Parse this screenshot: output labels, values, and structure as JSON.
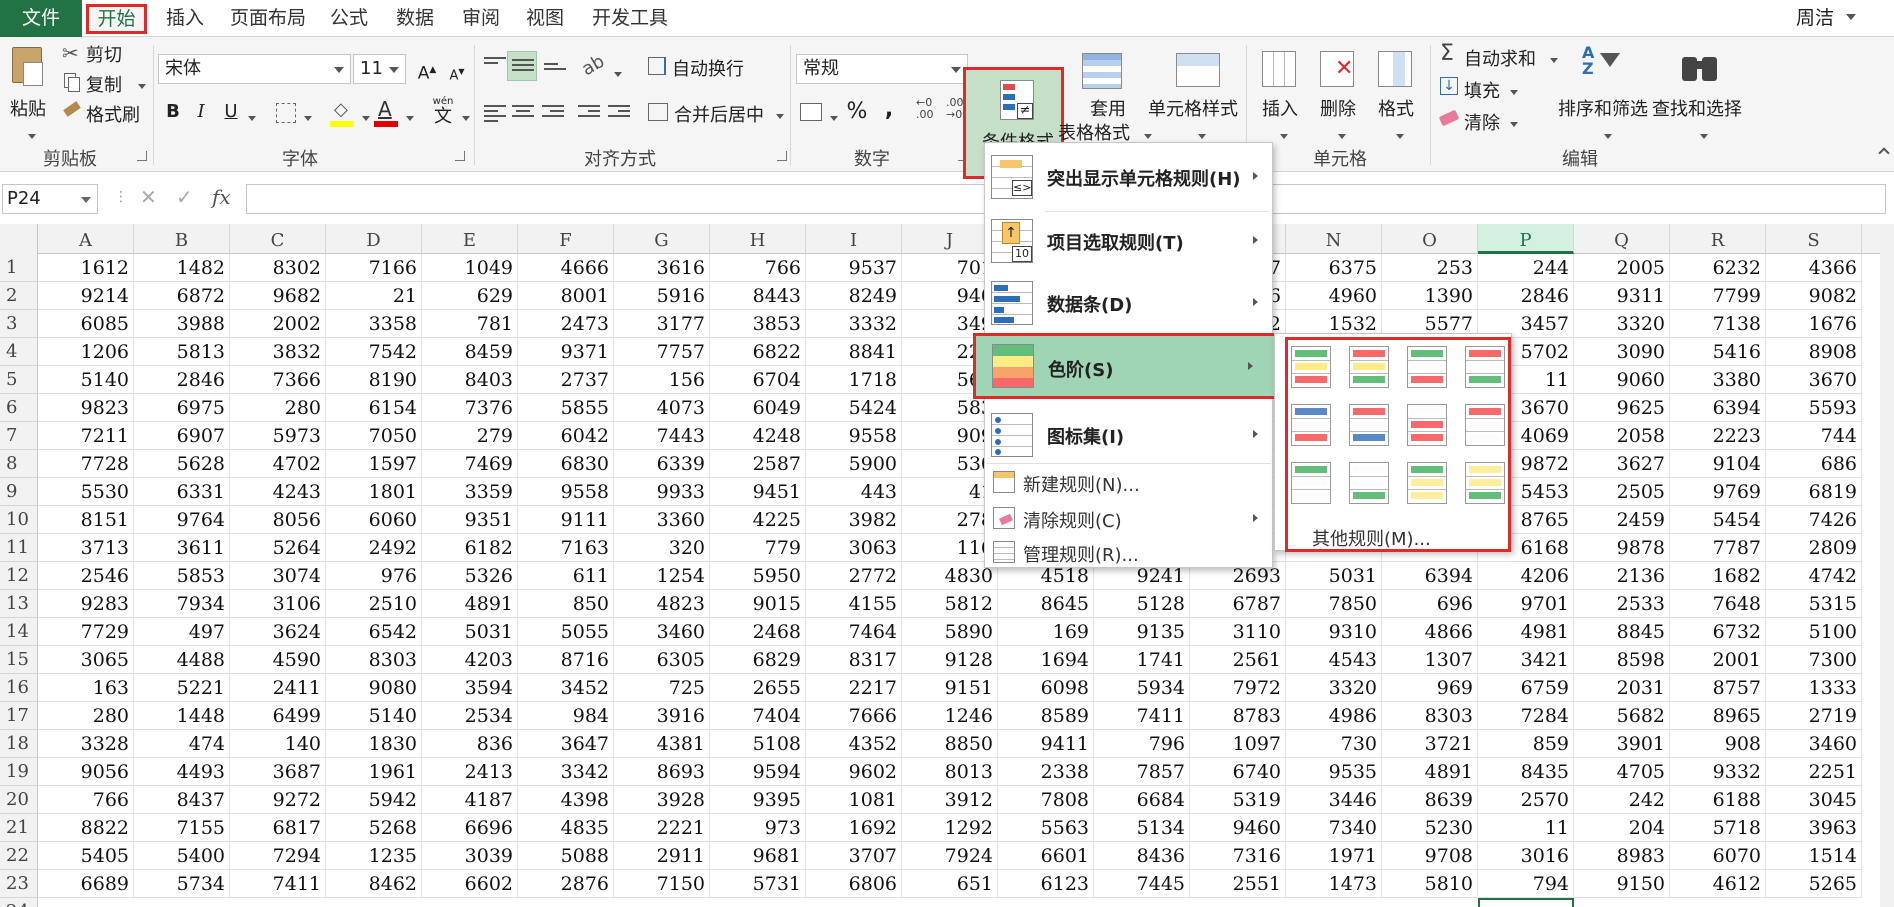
{
  "tabs": {
    "file": "文件",
    "home": "开始",
    "insert": "插入",
    "page_layout": "页面布局",
    "formulas": "公式",
    "data": "数据",
    "review": "审阅",
    "view": "视图",
    "developer": "开发工具",
    "user": "周洁"
  },
  "ribbon": {
    "clipboard": {
      "label": "剪贴板",
      "paste": "粘贴",
      "cut": "剪切",
      "copy": "复制",
      "format_painter": "格式刷"
    },
    "font": {
      "label": "字体",
      "font_name": "宋体",
      "font_size": "11",
      "bold": "B",
      "italic": "I",
      "underline": "U",
      "phonetic": "wén",
      "phonetic_char": "文"
    },
    "alignment": {
      "label": "对齐方式",
      "wrap": "自动换行",
      "merge": "合并后居中"
    },
    "number": {
      "label": "数字",
      "format": "常规",
      "percent": "%",
      "comma": ","
    },
    "styles": {
      "conditional": "条件格式",
      "table_line1": "套用",
      "table_line2": "表格格式",
      "cell_styles": "单元格样式"
    },
    "cells": {
      "label": "单元格",
      "insert": "插入",
      "delete": "删除",
      "format": "格式"
    },
    "editing": {
      "label": "编辑",
      "autosum": "自动求和",
      "fill": "填充",
      "clear": "清除",
      "sort": "排序和筛选",
      "find": "查找和选择"
    }
  },
  "formula_bar": {
    "name_box": "P24",
    "fx": "fx",
    "value": ""
  },
  "columns": [
    "A",
    "B",
    "C",
    "D",
    "E",
    "F",
    "G",
    "H",
    "I",
    "J",
    "K",
    "L",
    "M",
    "N",
    "O",
    "P",
    "Q",
    "R",
    "S"
  ],
  "selected_column": "P",
  "rows": [
    [
      "1612",
      "1482",
      "8302",
      "7166",
      "1049",
      "4666",
      "3616",
      "766",
      "9537",
      "701",
      "",
      "",
      "7",
      "6375",
      "253",
      "244",
      "2005",
      "6232",
      "4366"
    ],
    [
      "9214",
      "6872",
      "9682",
      "21",
      "629",
      "8001",
      "5916",
      "8443",
      "8249",
      "940",
      "",
      "",
      "6",
      "4960",
      "1390",
      "2846",
      "9311",
      "7799",
      "9082"
    ],
    [
      "6085",
      "3988",
      "2002",
      "3358",
      "781",
      "2473",
      "3177",
      "3853",
      "3332",
      "349",
      "",
      "",
      "2",
      "1532",
      "5577",
      "3457",
      "3320",
      "7138",
      "1676"
    ],
    [
      "1206",
      "5813",
      "3832",
      "7542",
      "8459",
      "9371",
      "7757",
      "6822",
      "8841",
      "223",
      "",
      "",
      "",
      "",
      "",
      "5702",
      "3090",
      "5416",
      "8908"
    ],
    [
      "5140",
      "2846",
      "7366",
      "8190",
      "8403",
      "2737",
      "156",
      "6704",
      "1718",
      "563",
      "",
      "",
      "",
      "",
      "",
      "11",
      "9060",
      "3380",
      "3670"
    ],
    [
      "9823",
      "6975",
      "280",
      "6154",
      "7376",
      "5855",
      "4073",
      "6049",
      "5424",
      "583",
      "",
      "",
      "",
      "",
      "",
      "3670",
      "9625",
      "6394",
      "5593"
    ],
    [
      "7211",
      "6907",
      "5973",
      "7050",
      "279",
      "6042",
      "7443",
      "4248",
      "9558",
      "909",
      "",
      "",
      "",
      "",
      "",
      "4069",
      "2058",
      "2223",
      "744"
    ],
    [
      "7728",
      "5628",
      "4702",
      "1597",
      "7469",
      "6830",
      "6339",
      "2587",
      "5900",
      "530",
      "",
      "",
      "",
      "",
      "",
      "9872",
      "3627",
      "9104",
      "686"
    ],
    [
      "5530",
      "6331",
      "4243",
      "1801",
      "3359",
      "9558",
      "9933",
      "9451",
      "443",
      "41",
      "",
      "",
      "",
      "",
      "",
      "5453",
      "2505",
      "9769",
      "6819"
    ],
    [
      "8151",
      "9764",
      "8056",
      "6060",
      "9351",
      "9111",
      "3360",
      "4225",
      "3982",
      "278",
      "",
      "",
      "",
      "",
      "",
      "8765",
      "2459",
      "5454",
      "7426"
    ],
    [
      "3713",
      "3611",
      "5264",
      "2492",
      "6182",
      "7163",
      "320",
      "779",
      "3063",
      "116",
      "",
      "",
      "",
      "",
      "",
      "6168",
      "9878",
      "7787",
      "2809"
    ],
    [
      "2546",
      "5853",
      "3074",
      "976",
      "5326",
      "611",
      "1254",
      "5950",
      "2772",
      "4830",
      "4518",
      "9241",
      "2693",
      "5031",
      "6394",
      "4206",
      "2136",
      "1682",
      "4742"
    ],
    [
      "9283",
      "7934",
      "3106",
      "2510",
      "4891",
      "850",
      "4823",
      "9015",
      "4155",
      "5812",
      "8645",
      "5128",
      "6787",
      "7850",
      "696",
      "9701",
      "2533",
      "7648",
      "5315"
    ],
    [
      "7729",
      "497",
      "3624",
      "6542",
      "5031",
      "5055",
      "3460",
      "2468",
      "7464",
      "5890",
      "169",
      "9135",
      "3110",
      "9310",
      "4866",
      "4981",
      "8845",
      "6732",
      "5100"
    ],
    [
      "3065",
      "4488",
      "4590",
      "8303",
      "4203",
      "8716",
      "6305",
      "6829",
      "8317",
      "9128",
      "1694",
      "1741",
      "2561",
      "4543",
      "1307",
      "3421",
      "8598",
      "2001",
      "7300"
    ],
    [
      "163",
      "5221",
      "2411",
      "9080",
      "3594",
      "3452",
      "725",
      "2655",
      "2217",
      "9151",
      "6098",
      "5934",
      "7972",
      "3320",
      "969",
      "6759",
      "2031",
      "8757",
      "1333"
    ],
    [
      "280",
      "1448",
      "6499",
      "5140",
      "2534",
      "984",
      "3916",
      "7404",
      "7666",
      "1246",
      "8589",
      "7411",
      "8783",
      "4986",
      "8303",
      "7284",
      "5682",
      "8965",
      "2719"
    ],
    [
      "3328",
      "474",
      "140",
      "1830",
      "836",
      "3647",
      "4381",
      "5108",
      "4352",
      "8850",
      "9411",
      "796",
      "1097",
      "730",
      "3721",
      "859",
      "3901",
      "908",
      "3460"
    ],
    [
      "9056",
      "4493",
      "3687",
      "1961",
      "2413",
      "3342",
      "8693",
      "9594",
      "9602",
      "8013",
      "2338",
      "7857",
      "6740",
      "9535",
      "4891",
      "8435",
      "4705",
      "9332",
      "2251"
    ],
    [
      "766",
      "8437",
      "9272",
      "5942",
      "4187",
      "4398",
      "3928",
      "9395",
      "1081",
      "3912",
      "7808",
      "6684",
      "5319",
      "3446",
      "8639",
      "2570",
      "242",
      "6188",
      "3045"
    ],
    [
      "8822",
      "7155",
      "6817",
      "5268",
      "6696",
      "4835",
      "2221",
      "973",
      "1692",
      "1292",
      "5563",
      "5134",
      "9460",
      "7340",
      "5230",
      "11",
      "204",
      "5718",
      "3963"
    ],
    [
      "5405",
      "5400",
      "7294",
      "1235",
      "3039",
      "5088",
      "2911",
      "9681",
      "3707",
      "7924",
      "6601",
      "8436",
      "7316",
      "1971",
      "9708",
      "3016",
      "8983",
      "6070",
      "1514"
    ],
    [
      "6689",
      "5734",
      "7411",
      "8462",
      "6602",
      "2876",
      "7150",
      "5731",
      "6806",
      "651",
      "6123",
      "7445",
      "2551",
      "1473",
      "5810",
      "794",
      "9150",
      "4612",
      "5265"
    ]
  ],
  "cf_menu": {
    "highlight": "突出显示单元格规则(H)",
    "top_bottom": "项目选取规则(T)",
    "data_bars": "数据条(D)",
    "color_scales": "色阶(S)",
    "icon_sets": "图标集(I)",
    "new_rule": "新建规则(N)...",
    "clear_rules": "清除规则(C)",
    "manage_rules": "管理规则(R)...",
    "top_icon_num": "10"
  },
  "color_scales_submenu": {
    "more_rules": "其他规则(M)...",
    "scales": [
      [
        "#63be7b",
        "#ffeb84",
        "#f8696b"
      ],
      [
        "#f8696b",
        "#ffeb84",
        "#63be7b"
      ],
      [
        "#63be7b",
        "#fcfcff",
        "#f8696b"
      ],
      [
        "#f8696b",
        "#fcfcff",
        "#63be7b"
      ],
      [
        "#5a8ac6",
        "#fcfcff",
        "#f8696b"
      ],
      [
        "#f8696b",
        "#fcfcff",
        "#5a8ac6"
      ],
      [
        "#fcfcff",
        "#f8696b",
        "#f8696b"
      ],
      [
        "#f8696b",
        "#fcfcff",
        "#fcfcff"
      ],
      [
        "#63be7b",
        "#fcfcff",
        "#fcfcff"
      ],
      [
        "#fcfcff",
        "#fcfcff",
        "#63be7b"
      ],
      [
        "#63be7b",
        "#ffef9c",
        "#ffef9c"
      ],
      [
        "#ffef9c",
        "#ffef9c",
        "#63be7b"
      ]
    ]
  },
  "colors": {
    "accent": "#217346",
    "highlight_border": "#e02a2a",
    "menu_selected": "#9fd5b5"
  }
}
